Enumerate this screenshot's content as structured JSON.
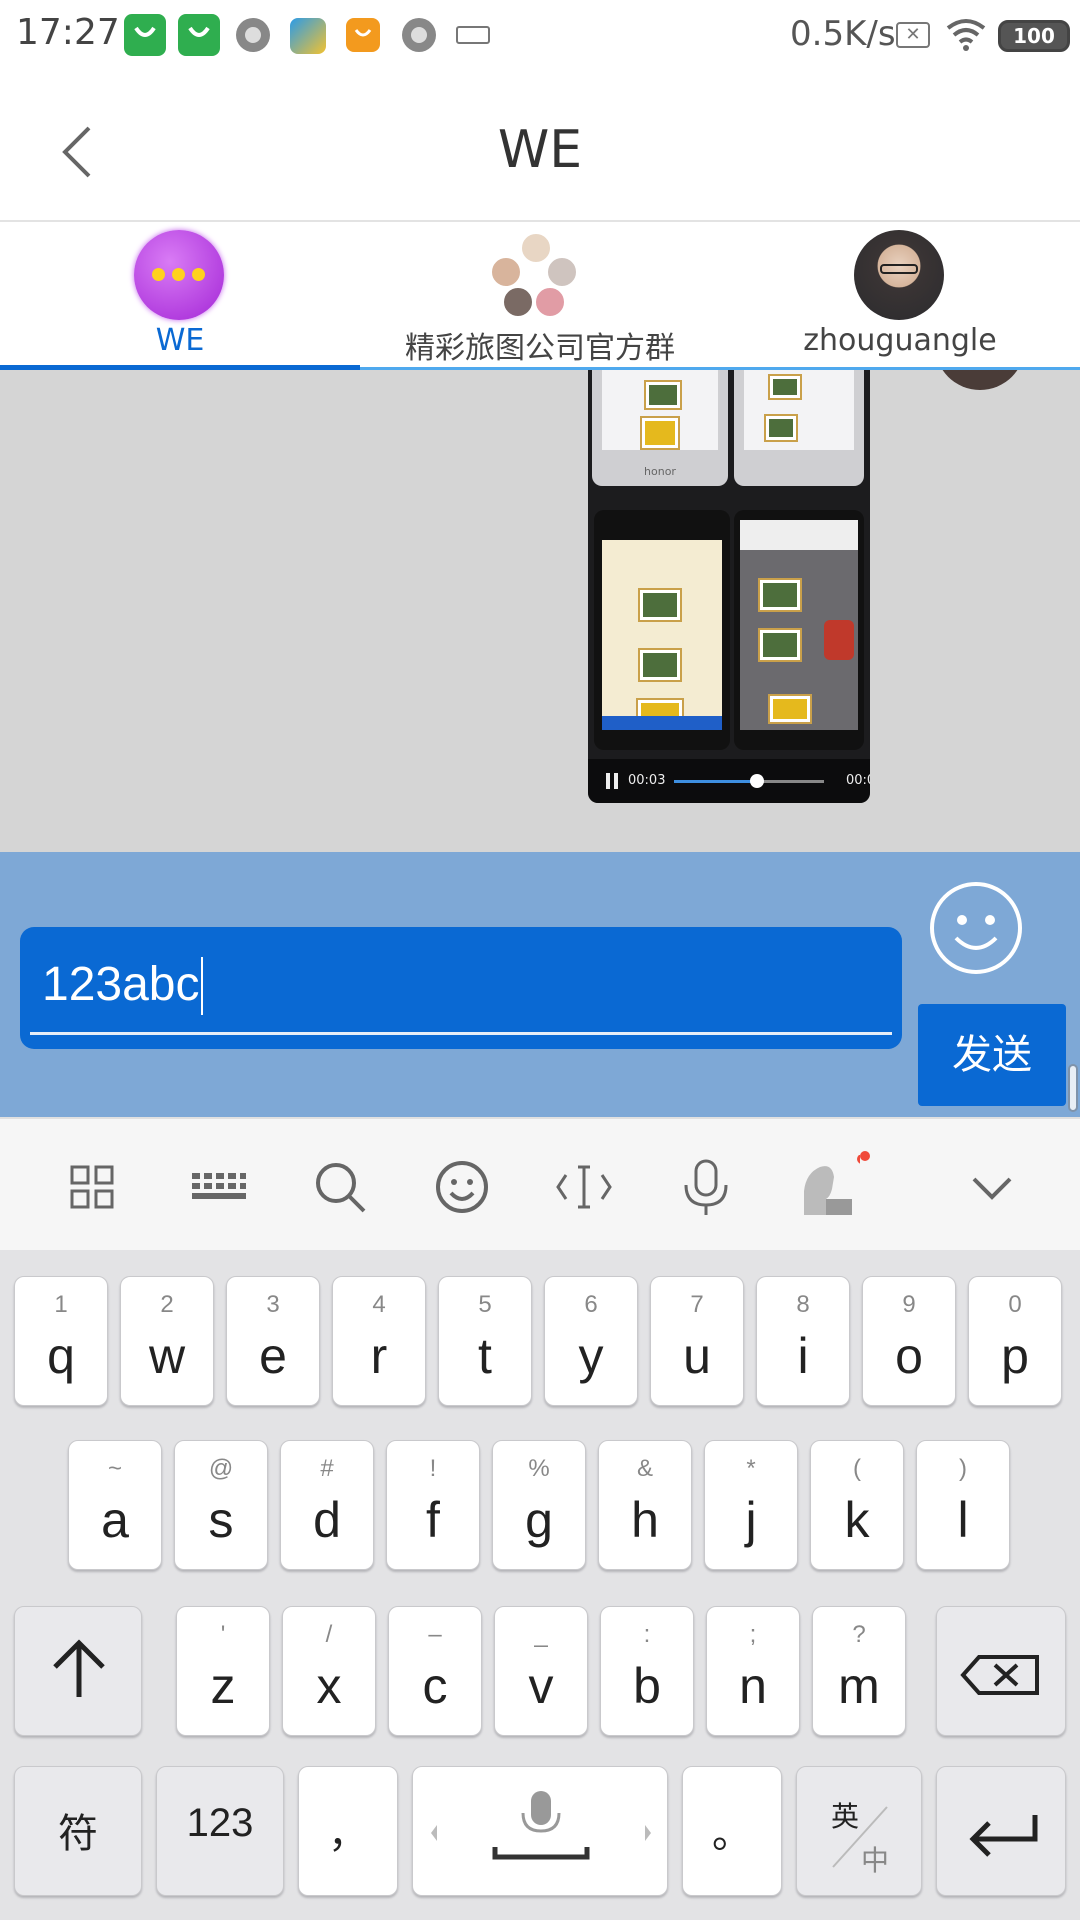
{
  "status_bar": {
    "time": "17:27",
    "network_speed": "0.5K/s",
    "battery": "100",
    "icons": [
      "taobao-icon",
      "taobao-icon",
      "circle-app-icon",
      "paper-plane-icon",
      "orange-app-icon",
      "circle-app-icon",
      "keyboard-icon",
      "sim-error-icon",
      "wifi-icon",
      "battery-icon"
    ]
  },
  "header": {
    "title": "WE",
    "back_icon": "chevron-left-icon"
  },
  "tabs": [
    {
      "label": "WE",
      "active": true,
      "avatar": "more-dots-avatar"
    },
    {
      "label": "精彩旅图公司官方群",
      "active": false,
      "avatar": "group-avatar"
    },
    {
      "label": "zhouguangle",
      "active": false,
      "avatar": "user-avatar"
    }
  ],
  "video": {
    "current_time": "00:03",
    "end_time": "00:0",
    "progress": 0.55,
    "phone_brand": "honor"
  },
  "input": {
    "value": "123abc",
    "send_label": "发送"
  },
  "keyboard_toolbar": [
    "grid-icon",
    "keyboard-icon",
    "search-icon",
    "emoji-icon",
    "cursor-icon",
    "microphone-icon",
    "avatar-ad-icon",
    "chevron-down-icon"
  ],
  "keyboard": {
    "row1": [
      {
        "sub": "1",
        "main": "q"
      },
      {
        "sub": "2",
        "main": "w"
      },
      {
        "sub": "3",
        "main": "e"
      },
      {
        "sub": "4",
        "main": "r"
      },
      {
        "sub": "5",
        "main": "t"
      },
      {
        "sub": "6",
        "main": "y"
      },
      {
        "sub": "7",
        "main": "u"
      },
      {
        "sub": "8",
        "main": "i"
      },
      {
        "sub": "9",
        "main": "o"
      },
      {
        "sub": "0",
        "main": "p"
      }
    ],
    "row2": [
      {
        "sub": "~",
        "main": "a"
      },
      {
        "sub": "@",
        "main": "s"
      },
      {
        "sub": "#",
        "main": "d"
      },
      {
        "sub": "!",
        "main": "f"
      },
      {
        "sub": "%",
        "main": "g"
      },
      {
        "sub": "&",
        "main": "h"
      },
      {
        "sub": "*",
        "main": "j"
      },
      {
        "sub": "(",
        "main": "k"
      },
      {
        "sub": ")",
        "main": "l"
      }
    ],
    "row3": [
      {
        "sub": "'",
        "main": "z"
      },
      {
        "sub": "/",
        "main": "x"
      },
      {
        "sub": "–",
        "main": "c"
      },
      {
        "sub": "_",
        "main": "v"
      },
      {
        "sub": ":",
        "main": "b"
      },
      {
        "sub": ";",
        "main": "n"
      },
      {
        "sub": "?",
        "main": "m"
      }
    ],
    "bottom": {
      "symbols": "符",
      "numbers": "123",
      "comma": "，",
      "period": "。",
      "lang_top": "英",
      "lang_bottom": "中"
    }
  },
  "colors": {
    "accent": "#0a69d3",
    "input_bar": "#7ea8d6",
    "chat_bg": "#d5d5d5"
  }
}
